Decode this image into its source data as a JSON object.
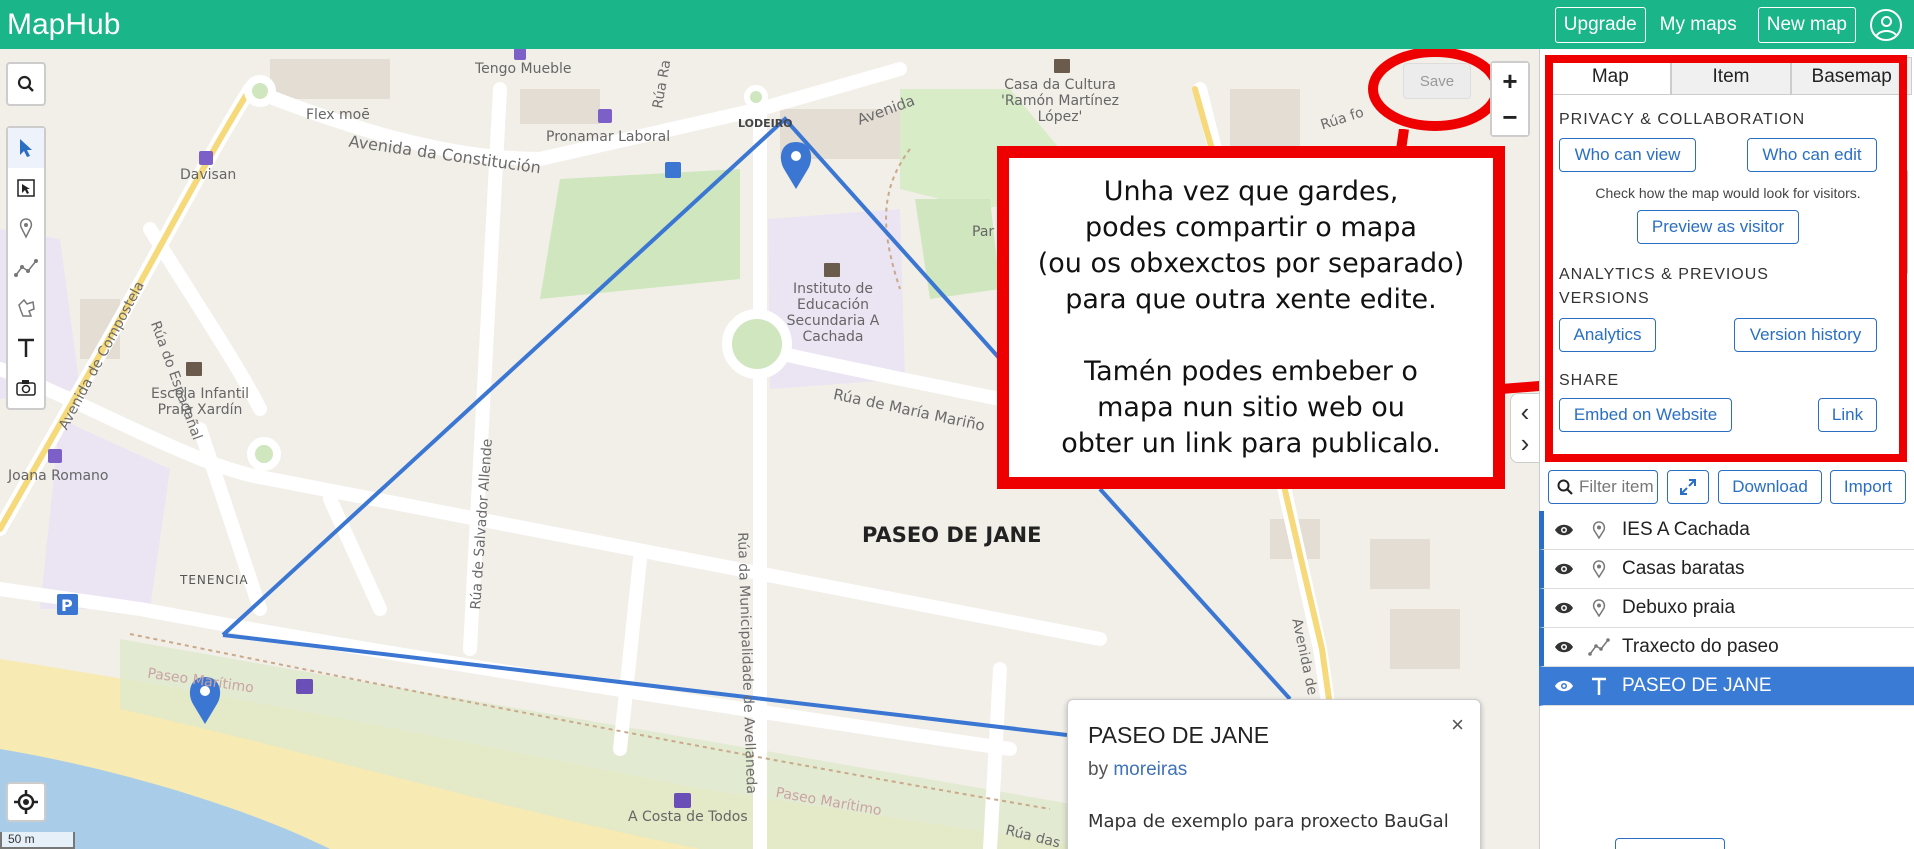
{
  "topbar": {
    "brand": "MapHub",
    "upgrade": "Upgrade",
    "my_maps": "My maps",
    "new_map": "New map"
  },
  "map": {
    "save_label": "Save",
    "zoom_in": "+",
    "zoom_out": "−",
    "scale": "50 m",
    "paseo_label": "PASEO DE JANE",
    "places": {
      "tengo": "Tengo Mueble",
      "flex": "Flex moē",
      "pronamar": "Pronamar Laboral",
      "lodeiro": "LODEIRO",
      "davisan": "Davisan",
      "casa_cultura": "Casa da Cultura 'Ramón Martínez López'",
      "instituto": "Instituto de Educación Secundaria A Cachada",
      "escola": "Escola Infantil Praia Xardín",
      "joana": "Joana Romano",
      "tenencia": "TENENCIA",
      "costa": "A Costa de Todos",
      "par": "Par"
    },
    "streets": {
      "constitucion": "Avenida da Constitución",
      "espadanal": "Rúa do Espadañal",
      "compostela": "Avenida de Compostela",
      "salvador": "Rúa de Salvador Allende",
      "municipalidade": "Rúa da Municipalidade de Avellaneda",
      "maria": "Rúa de María Mariño",
      "barana": "Avenida de Baraña",
      "paseo_maritimo": "Paseo Marítimo",
      "paseo_maritimo2": "Paseo Marítimo",
      "avenida_top": "Avenida",
      "rua_ra": "Rúa Ra",
      "rua_fo": "Rúa fo",
      "ruadas": "Rúa das"
    }
  },
  "callout": {
    "line1": "Unha vez que gardes,",
    "line2": "podes compartir o mapa",
    "line3": "(ou os obxexctos por separado)",
    "line4": "para que outra xente edite.",
    "line5": "Tamén podes embeber o",
    "line6": "mapa nun sitio web ou",
    "line7": "obter un link para publicalo."
  },
  "popup": {
    "title": "PASEO DE JANE",
    "by": "by",
    "author": "moreiras",
    "description": "Mapa de exemplo para proxecto BauGal",
    "close": "×"
  },
  "sidebar": {
    "tabs": [
      "Map",
      "Item",
      "Basemap"
    ],
    "privacy_title": "PRIVACY & COLLABORATION",
    "who_view": "Who can view",
    "who_edit": "Who can edit",
    "hint": "Check how the map would look for visitors.",
    "preview": "Preview as visitor",
    "analytics_title_1": "ANALYTICS & PREVIOUS",
    "analytics_title_2": "VERSIONS",
    "analytics": "Analytics",
    "version_history": "Version history",
    "share_title": "SHARE",
    "embed": "Embed on Website",
    "link": "Link",
    "filter_placeholder": "Filter items",
    "download": "Download",
    "import": "Import",
    "items": [
      {
        "label": "IES A Cachada",
        "type": "marker"
      },
      {
        "label": "Casas baratas",
        "type": "marker"
      },
      {
        "label": "Debuxo praia",
        "type": "marker"
      },
      {
        "label": "Traxecto do paseo",
        "type": "line"
      },
      {
        "label": "PASEO DE JANE",
        "type": "text"
      }
    ]
  },
  "colors": {
    "brand": "#1ab588",
    "accent": "#2a6fc4",
    "highlight": "#ee0000",
    "route": "#3a76d2"
  }
}
